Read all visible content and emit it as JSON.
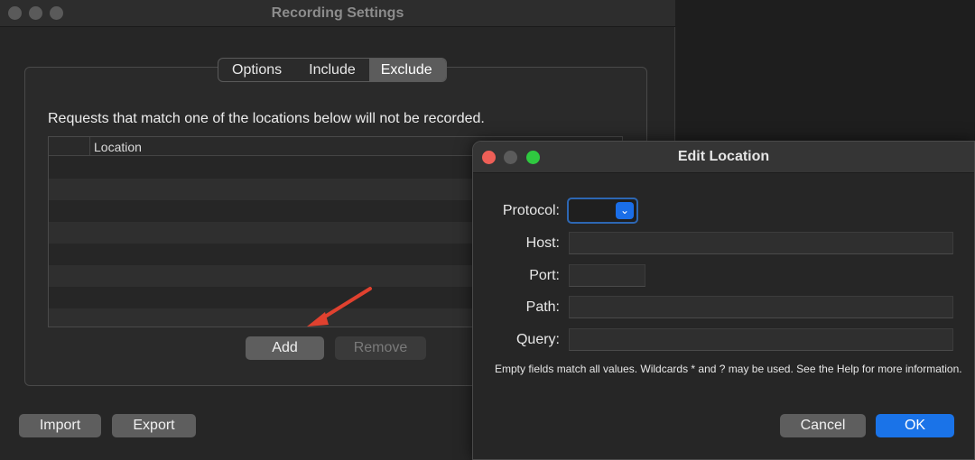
{
  "main_window": {
    "title": "Recording Settings",
    "tabs": [
      {
        "label": "Options",
        "selected": false
      },
      {
        "label": "Include",
        "selected": false
      },
      {
        "label": "Exclude",
        "selected": true
      }
    ],
    "description": "Requests that match one of the locations below will not be recorded.",
    "table": {
      "columns": [
        "",
        "Location"
      ],
      "rows": []
    },
    "buttons": {
      "add": "Add",
      "remove": "Remove",
      "import": "Import",
      "export": "Export"
    }
  },
  "dialog": {
    "title": "Edit Location",
    "fields": {
      "protocol": {
        "label": "Protocol:",
        "value": ""
      },
      "host": {
        "label": "Host:",
        "value": ""
      },
      "port": {
        "label": "Port:",
        "value": ""
      },
      "path": {
        "label": "Path:",
        "value": ""
      },
      "query": {
        "label": "Query:",
        "value": ""
      }
    },
    "help_text": "Empty fields match all values. Wildcards * and ? may be used. See the Help for more information.",
    "buttons": {
      "cancel": "Cancel",
      "ok": "OK"
    }
  },
  "colors": {
    "accent": "#1a73e8",
    "annotation_arrow": "#e0412f"
  }
}
